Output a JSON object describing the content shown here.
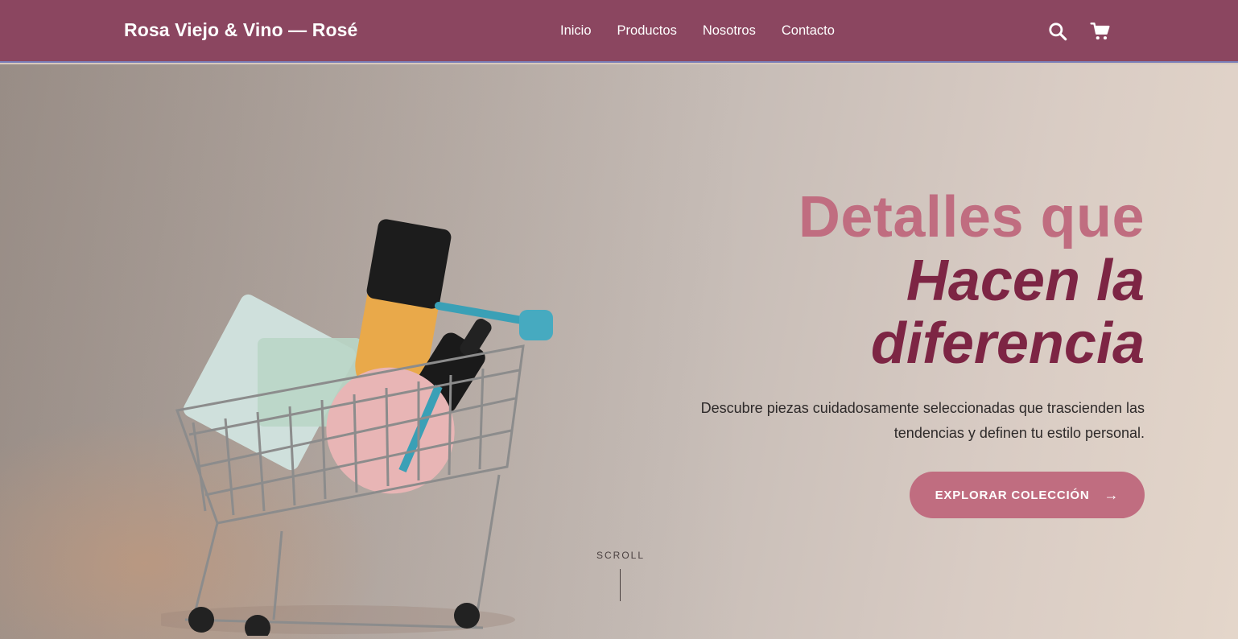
{
  "header": {
    "brand": "Rosa Viejo & Vino — Rosé",
    "nav": [
      "Inicio",
      "Productos",
      "Nosotros",
      "Contacto"
    ],
    "icons": [
      "search-icon",
      "cart-icon"
    ]
  },
  "hero": {
    "title_line1": "Detalles que",
    "title_line2": "Hacen la",
    "title_line3": "diferencia",
    "description": "Descubre piezas cuidadosamente seleccionadas que trascienden las tendencias y definen tu estilo personal.",
    "cta_label": "EXPLORAR COLECCIÓN",
    "cta_icon": "arrow-right-icon",
    "scroll_label": "SCROLL"
  },
  "colors": {
    "header_bg": "#8b4660",
    "accent_rose": "#c06d80",
    "accent_wine": "#7d2544"
  }
}
